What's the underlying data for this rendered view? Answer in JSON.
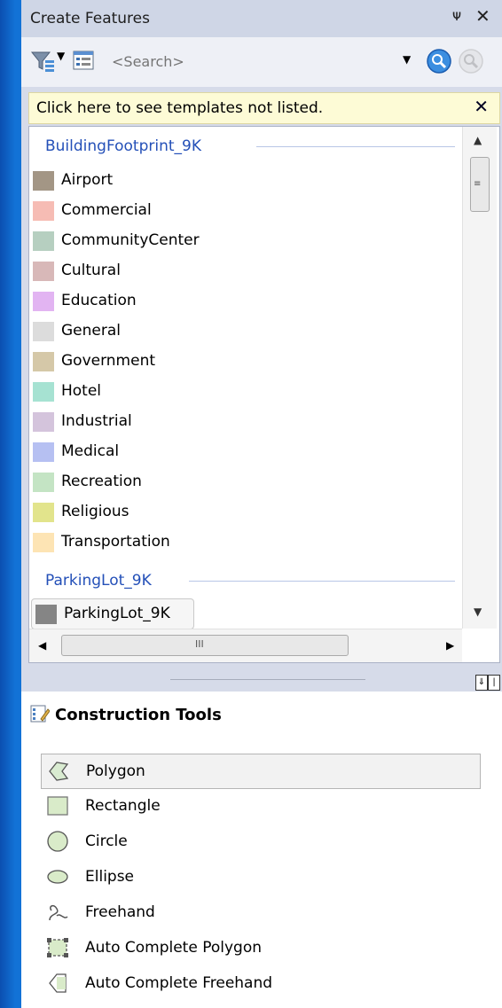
{
  "window": {
    "title": "Create Features",
    "pin_glyph": "Ͱ",
    "close_glyph": "✕"
  },
  "toolbar": {
    "filter_icon": "filter-templates-icon",
    "organize_icon": "organize-templates-icon",
    "search_placeholder": "<Search>",
    "search_icon": "magnifier-icon",
    "clear_icon": "clear-search-icon"
  },
  "infobar": {
    "text": "Click here to see templates not listed.",
    "close": "✕"
  },
  "groups": [
    {
      "name": "BuildingFootprint_9K",
      "items": [
        {
          "label": "Airport",
          "color": "#a39685"
        },
        {
          "label": "Commercial",
          "color": "#f6bcb4"
        },
        {
          "label": "CommunityCenter",
          "color": "#b6cfc0"
        },
        {
          "label": "Cultural",
          "color": "#d8b8b8"
        },
        {
          "label": "Education",
          "color": "#e2b4f2"
        },
        {
          "label": "General",
          "color": "#dcdcdc"
        },
        {
          "label": "Government",
          "color": "#d5c8a8"
        },
        {
          "label": "Hotel",
          "color": "#a6e2d2"
        },
        {
          "label": "Industrial",
          "color": "#d4c4dc"
        },
        {
          "label": "Medical",
          "color": "#b6c0f2"
        },
        {
          "label": "Recreation",
          "color": "#c4e4c4"
        },
        {
          "label": "Religious",
          "color": "#e2e48c"
        },
        {
          "label": "Transportation",
          "color": "#fde4b4"
        }
      ]
    },
    {
      "name": "ParkingLot_9K",
      "items": [
        {
          "label": "ParkingLot_9K",
          "color": "#858585",
          "selected": true
        }
      ]
    }
  ],
  "scroll": {
    "up": "▲",
    "down": "▼",
    "left": "◀",
    "right": "▶",
    "grip_v": "≡",
    "grip_h": "III"
  },
  "construction": {
    "title": "Construction Tools",
    "tools": [
      {
        "label": "Polygon",
        "icon": "polygon-icon",
        "selected": true
      },
      {
        "label": "Rectangle",
        "icon": "rectangle-icon"
      },
      {
        "label": "Circle",
        "icon": "circle-icon"
      },
      {
        "label": "Ellipse",
        "icon": "ellipse-icon"
      },
      {
        "label": "Freehand",
        "icon": "freehand-icon"
      },
      {
        "label": "Auto Complete Polygon",
        "icon": "auto-complete-polygon-icon"
      },
      {
        "label": "Auto Complete Freehand",
        "icon": "auto-complete-freehand-icon"
      }
    ]
  }
}
